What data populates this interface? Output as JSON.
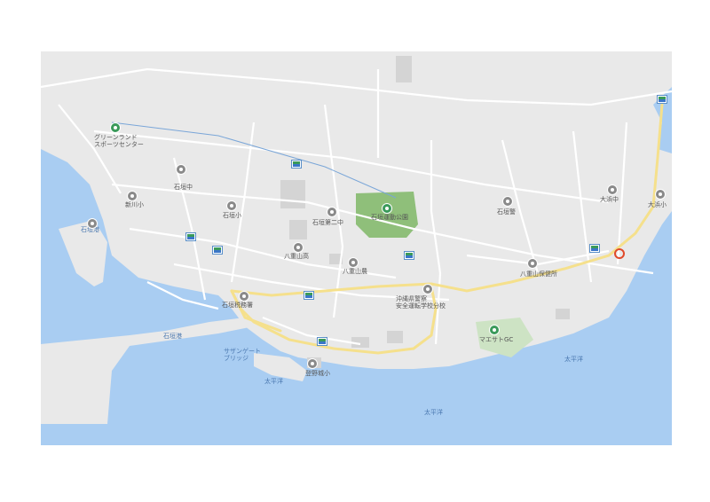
{
  "labels": {
    "green_land": "グリーンランド\nスポーツセンター",
    "ishigaki_port_n": "石垣港",
    "ishigaki_port_s": "石垣港",
    "shinkawa_sho": "新川小",
    "ishigaki_chu": "石垣中",
    "ishigaki_sho": "石垣小",
    "dai3_chu": "石垣第二中",
    "yaeyama_ko": "八重山高",
    "yaeyama_nogyo": "八重山農",
    "park": "石垣運動公園",
    "ishigaki_kai": "石垣警",
    "police_school": "沖縄県警察\n安全運転学校分校",
    "yaeyama_hoken": "八重山保健所",
    "ohama_chu": "大浜中",
    "ohama_sho": "大浜小",
    "tax_office": "石垣税務署",
    "bridge": "サザンゲート\nブリッジ",
    "tonoshiro": "登野城小",
    "golf": "マエサトGC",
    "pacific_1": "太平洋",
    "pacific_2": "太平洋",
    "pacific_3": "太平洋"
  },
  "colors": {
    "land": "#e9e9e9",
    "sea": "#a9cdf2",
    "road": "#ffffff",
    "main_road": "#f5e08c",
    "park": "#8fbf7a",
    "building": "#d4d4d4",
    "marker": "#e04a2a"
  },
  "icons": {
    "school": "school-icon",
    "bus_stop": "bus-stop-icon",
    "park": "park-icon",
    "highlight": "highlight-circle-icon"
  }
}
